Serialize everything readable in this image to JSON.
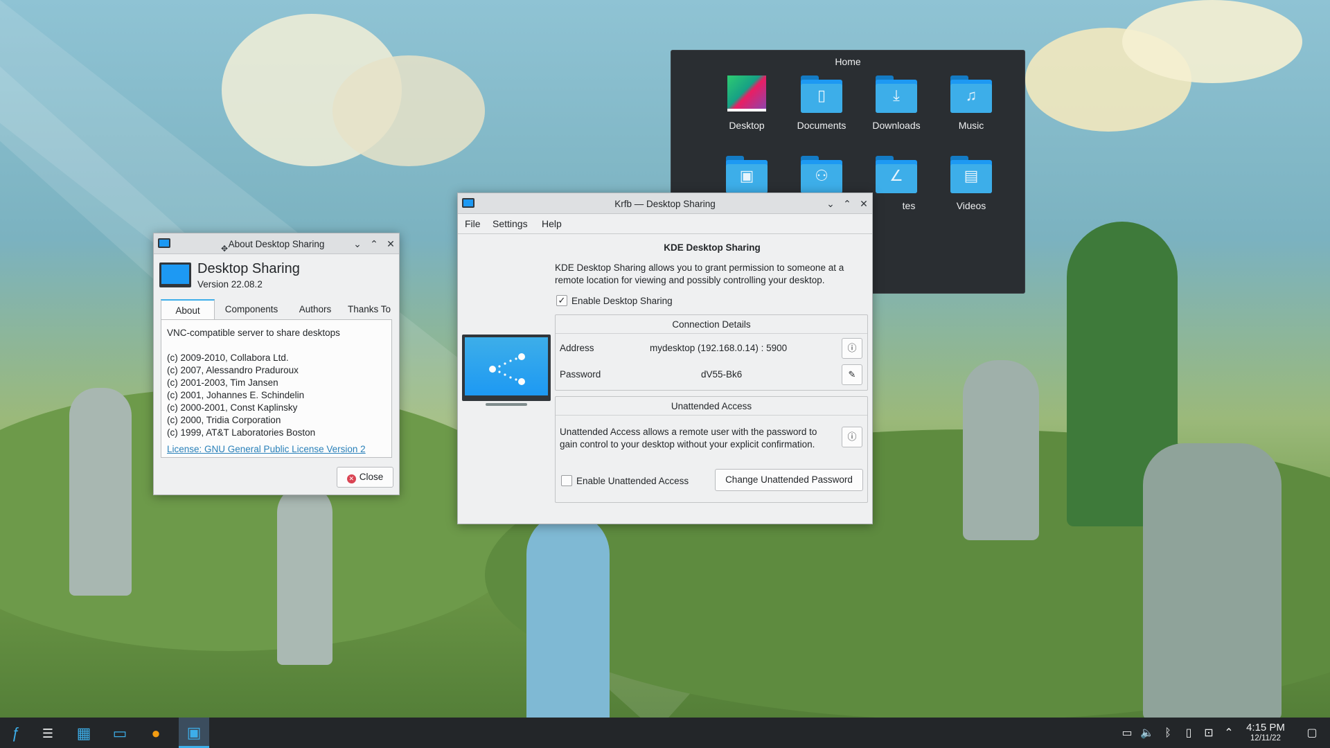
{
  "home_popup": {
    "title": "Home",
    "places": [
      {
        "label": "Desktop",
        "icon": "desktop-icon"
      },
      {
        "label": "Documents",
        "icon": "documents-folder-icon"
      },
      {
        "label": "Downloads",
        "icon": "downloads-folder-icon"
      },
      {
        "label": "Music",
        "icon": "music-folder-icon"
      },
      {
        "label": "",
        "icon": "pictures-folder-icon"
      },
      {
        "label": "",
        "icon": "public-folder-icon"
      },
      {
        "label": "tes",
        "icon": "templates-folder-icon"
      },
      {
        "label": "Videos",
        "icon": "videos-folder-icon"
      }
    ]
  },
  "about_dialog": {
    "title": "About Desktop Sharing",
    "app_name": "Desktop Sharing",
    "version": "Version 22.08.2",
    "tabs": [
      "About",
      "Components",
      "Authors",
      "Thanks To"
    ],
    "description": "VNC-compatible server to share desktops",
    "copyrights": [
      "(c) 2009-2010, Collabora Ltd.",
      "(c) 2007, Alessandro Praduroux",
      "(c) 2001-2003, Tim Jansen",
      "(c) 2001, Johannes E. Schindelin",
      "(c) 2000-2001, Const Kaplinsky",
      "(c) 2000, Tridia Corporation",
      "(c) 1999, AT&T Laboratories Boston"
    ],
    "license_link": "License: GNU General Public License Version 2",
    "close_label": "Close"
  },
  "krfb": {
    "title": "Krfb — Desktop Sharing",
    "menu": [
      "File",
      "Settings",
      "Help"
    ],
    "heading": "KDE Desktop Sharing",
    "intro": "KDE Desktop Sharing allows you to grant permission to someone at a remote location for viewing and possibly controlling your desktop.",
    "enable_sharing_label": "Enable Desktop Sharing",
    "enable_sharing_checked": true,
    "connection": {
      "title": "Connection Details",
      "address_label": "Address",
      "address_value": "mydesktop (192.168.0.14) : 5900",
      "password_label": "Password",
      "password_value": "dV55-Bk6"
    },
    "unattended": {
      "title": "Unattended Access",
      "description": "Unattended Access allows a remote user with the password to gain control to your desktop without your explicit confirmation.",
      "enable_label": "Enable Unattended Access",
      "enable_checked": false,
      "change_password_label": "Change Unattended Password"
    }
  },
  "taskbar": {
    "time": "4:15 PM",
    "date": "12/11/22"
  }
}
